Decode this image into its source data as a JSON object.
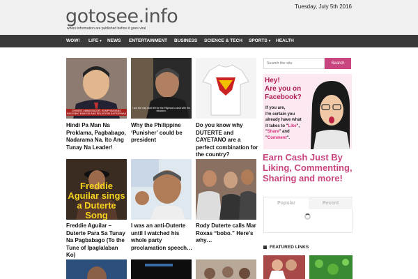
{
  "site": {
    "logo_text": "gotosee",
    "logo_ext": ".info",
    "tagline": "where information are published before it goes viral",
    "date": "Tuesday, July 5th 2016"
  },
  "nav": {
    "items": [
      {
        "label": "WOW!"
      },
      {
        "label": "LIFE"
      },
      {
        "label": "NEWS"
      },
      {
        "label": "ENTERTAINMENT"
      },
      {
        "label": "BUSINESS"
      },
      {
        "label": "SCIENCE & TECH"
      },
      {
        "label": "SPORTS"
      },
      {
        "label": "HEALTH"
      }
    ]
  },
  "articles": [
    {
      "title": "Hindi Pa Man Na Proklama, Pagbabago, Nadarama Na. Ito Ang Tunay Na Leader!",
      "caption": "CHINESE AMBASSADOR, KUMPIYANSANG MAGIGING MAAYOS ANG RELASYON SA PILIPINAS"
    },
    {
      "title": "Why the Philippine ‘Punisher’ could be president",
      "caption": "I am the only card left for the Filipinos to deal with the situation."
    },
    {
      "title": "Do you know why DUTERTE and CAYETANO are a perfect combination for the country?",
      "caption": ""
    },
    {
      "title": "Freddie Aguilar – Duterte Para Sa Tunay Na Pagbabago (To the Tune of Ipaglalaban Ko)",
      "caption": "Freddie Aguilar sings a Duterte Song"
    },
    {
      "title": "I was an anti-Duterte until I watched his whole party proclamation speech…",
      "caption": ""
    },
    {
      "title": "Rody Duterte calls Mar Roxas “bobo.” Here’s why…",
      "caption": ""
    }
  ],
  "sidebar": {
    "search_placeholder": "Search the site",
    "search_button": "Search",
    "ad_hey": "Hey!\nAre you on\nFacebook?",
    "ad_line1": "If you are,",
    "ad_line2": "I'm certain you",
    "ad_line3": "already have what",
    "ad_line4": "it takes to \"",
    "ad_like": "Like",
    "ad_share": "Share",
    "ad_comment": "Comment",
    "cash_text": "Earn Cash Just By Liking, Commenting, Sharing and more!",
    "tab_popular": "Popular",
    "tab_recent": "Recent",
    "featured_title": "FEATURED LINKS"
  },
  "colors": {
    "accent": "#c9457f",
    "nav_bg": "#3a3a3a"
  }
}
